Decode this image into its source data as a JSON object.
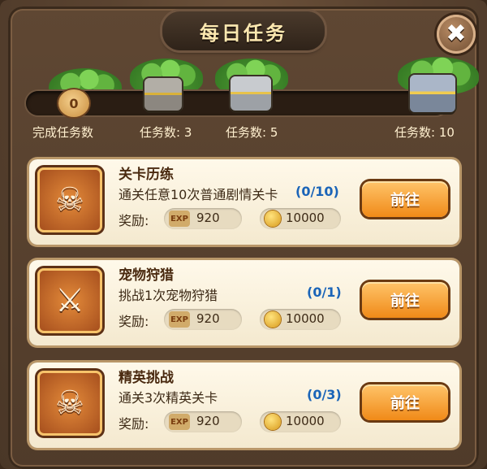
{
  "title": "每日任务",
  "close_icon": "close-icon",
  "progress": {
    "current": 0,
    "fraction": 0,
    "start_label": "完成任务数",
    "milestones": [
      {
        "label": "任务数: 3",
        "icon": "bronze-chest-icon"
      },
      {
        "label": "任务数: 5",
        "icon": "silver-chest-icon"
      },
      {
        "label": "任务数: 10",
        "icon": "gold-chest-icon"
      }
    ]
  },
  "reward_label": "奖励:",
  "exp_tag": "EXP",
  "tasks": [
    {
      "name": "关卡历练",
      "desc": "通关任意10次普通剧情关卡",
      "progress": "(0/10)",
      "exp": "920",
      "coins": "10000",
      "button": "前往",
      "icon": "skull-crossed-swords-icon"
    },
    {
      "name": "宠物狩猎",
      "desc": "挑战1次宠物狩猎",
      "progress": "(0/1)",
      "exp": "920",
      "coins": "10000",
      "button": "前往",
      "icon": "beast-spear-icon"
    },
    {
      "name": "精英挑战",
      "desc": "通关3次精英关卡",
      "progress": "(0/3)",
      "exp": "920",
      "coins": "10000",
      "button": "前往",
      "icon": "crowned-skull-icon"
    }
  ],
  "colors": {
    "accent": "#f08a18",
    "progress_text": "#1a64b8",
    "title_text": "#fde8b0"
  }
}
